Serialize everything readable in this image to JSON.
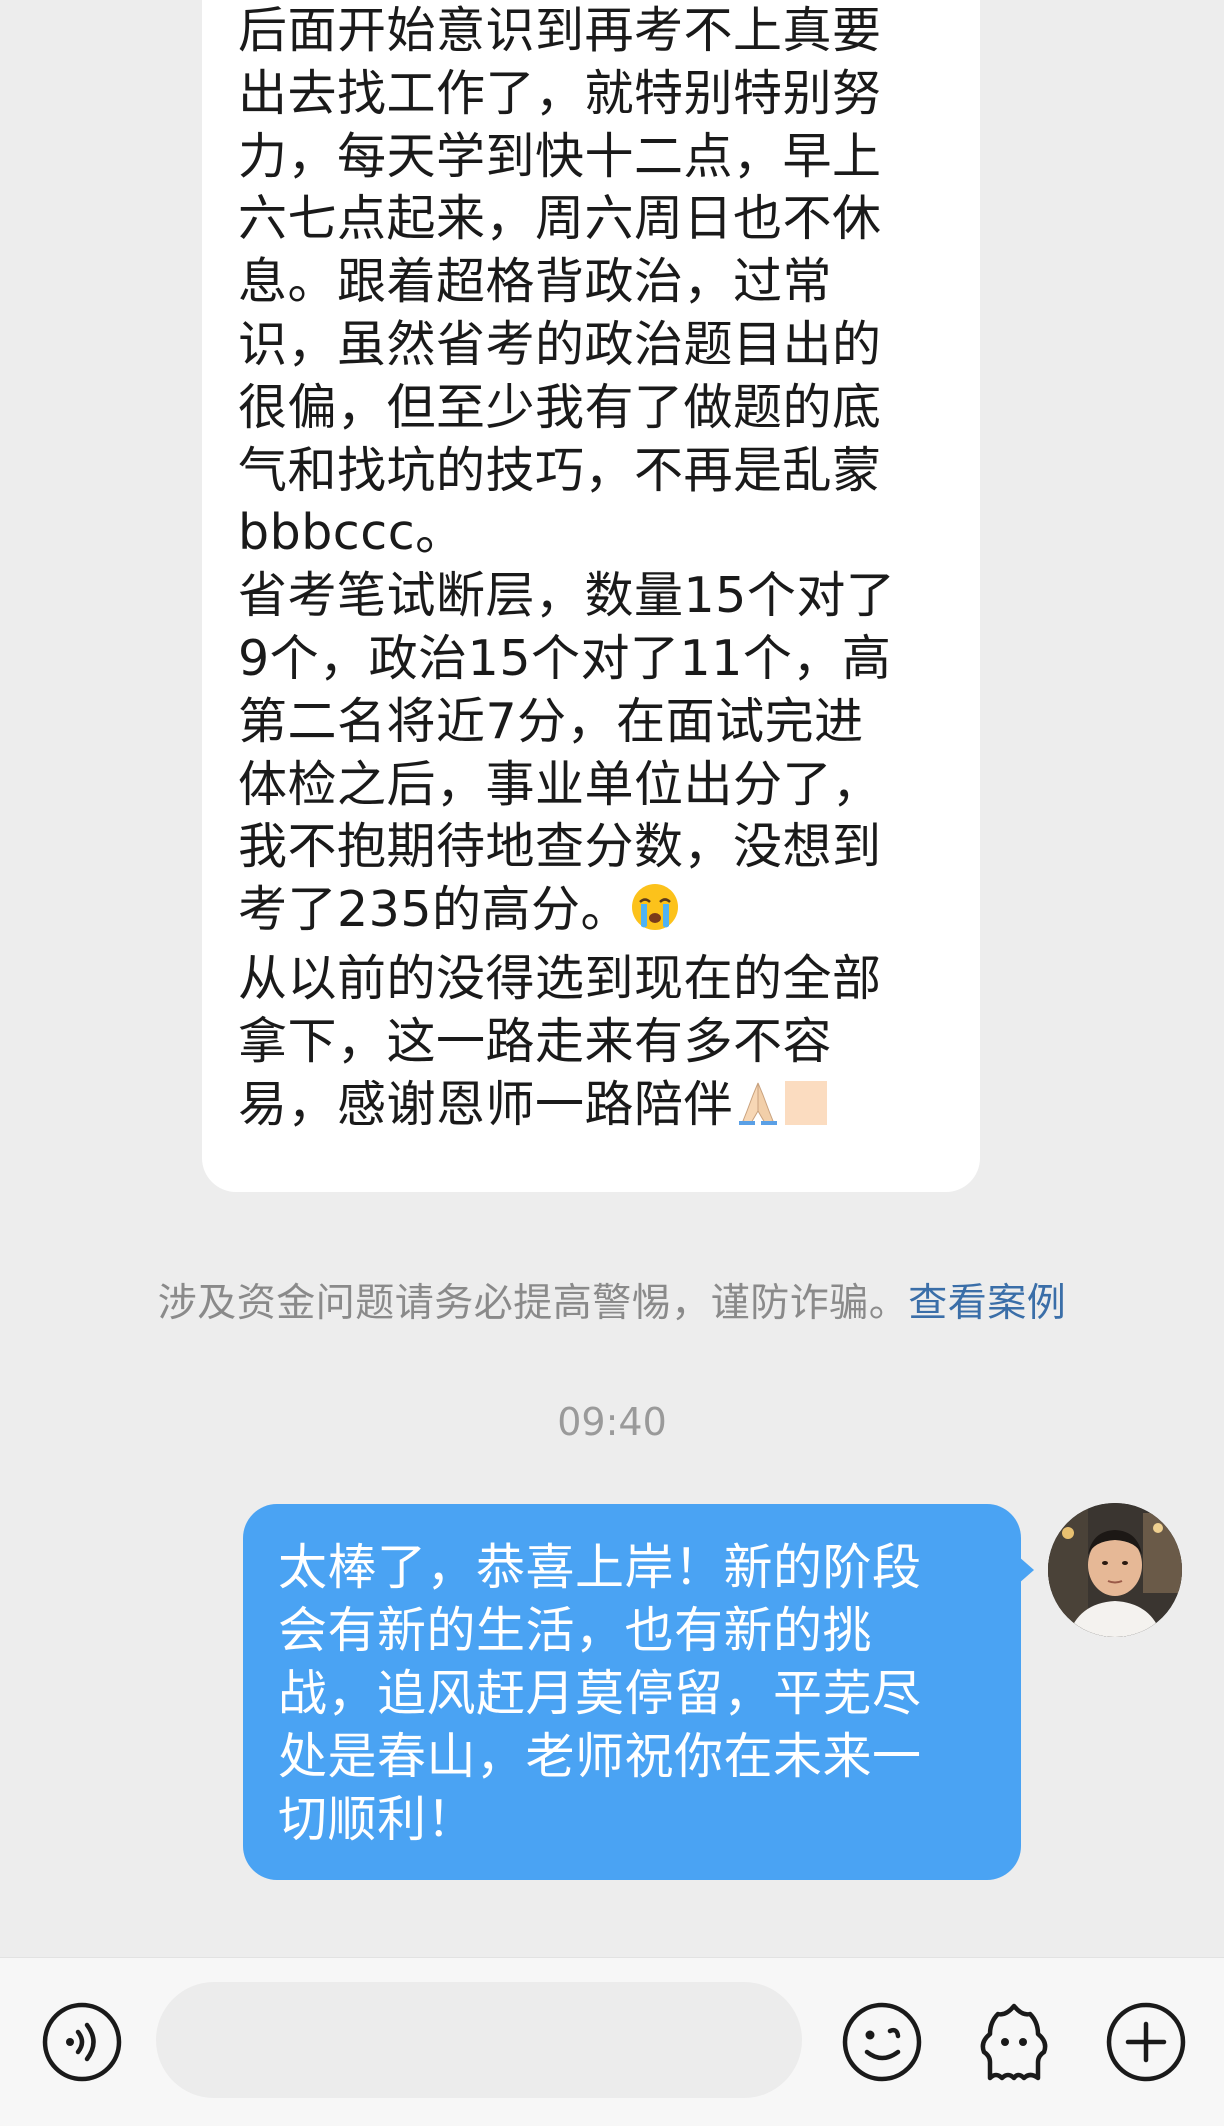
{
  "chat": {
    "incoming": {
      "lines": [
        "后面开始意识到再考不上真要",
        "出去找工作了，就特别特别努",
        "力，每天学到快十二点，早上",
        "六七点起来，周六周日也不休",
        "息。跟着超格背政治，过常",
        "识，虽然省考的政治题目出的",
        "很偏，但至少我有了做题的底",
        "气和找坑的技巧，不再是乱蒙",
        "bbbccc。",
        "省考笔试断层，数量15个对了",
        "9个，政治15个对了11个，高",
        "第二名将近7分，在面试完进",
        "体检之后，事业单位出分了，",
        "我不抱期待地查分数，没想到",
        "考了235的高分。",
        "从以前的没得选到现在的全部",
        "拿下，这一路走来有多不容",
        "易，感谢恩师一路陪伴"
      ],
      "emoji_crying": "crying-face-emoji",
      "emoji_pray": "folded-hands-emoji"
    },
    "security_notice": {
      "text": "涉及资金问题请务必提高警惕，谨防诈骗。",
      "link": "查看案例"
    },
    "timestamp": "09:40",
    "outgoing": {
      "lines": [
        "太棒了，恭喜上岸！新的阶段",
        "会有新的生活，也有新的挑",
        "战，追风赶月莫停留，平芜尽",
        "处是春山，老师祝你在未来一",
        "切顺利！"
      ]
    }
  },
  "input_bar": {
    "voice_icon": "voice-wave-icon",
    "placeholder": "",
    "emoji_icon": "smiley-icon",
    "sticker_icon": "sticker-ghost-icon",
    "more_icon": "plus-circle-icon"
  },
  "colors": {
    "background": "#ededed",
    "incoming_bubble": "#ffffff",
    "outgoing_bubble": "#4aa3f3",
    "link": "#3a6ea8",
    "notice_text": "#8a8a8a"
  }
}
